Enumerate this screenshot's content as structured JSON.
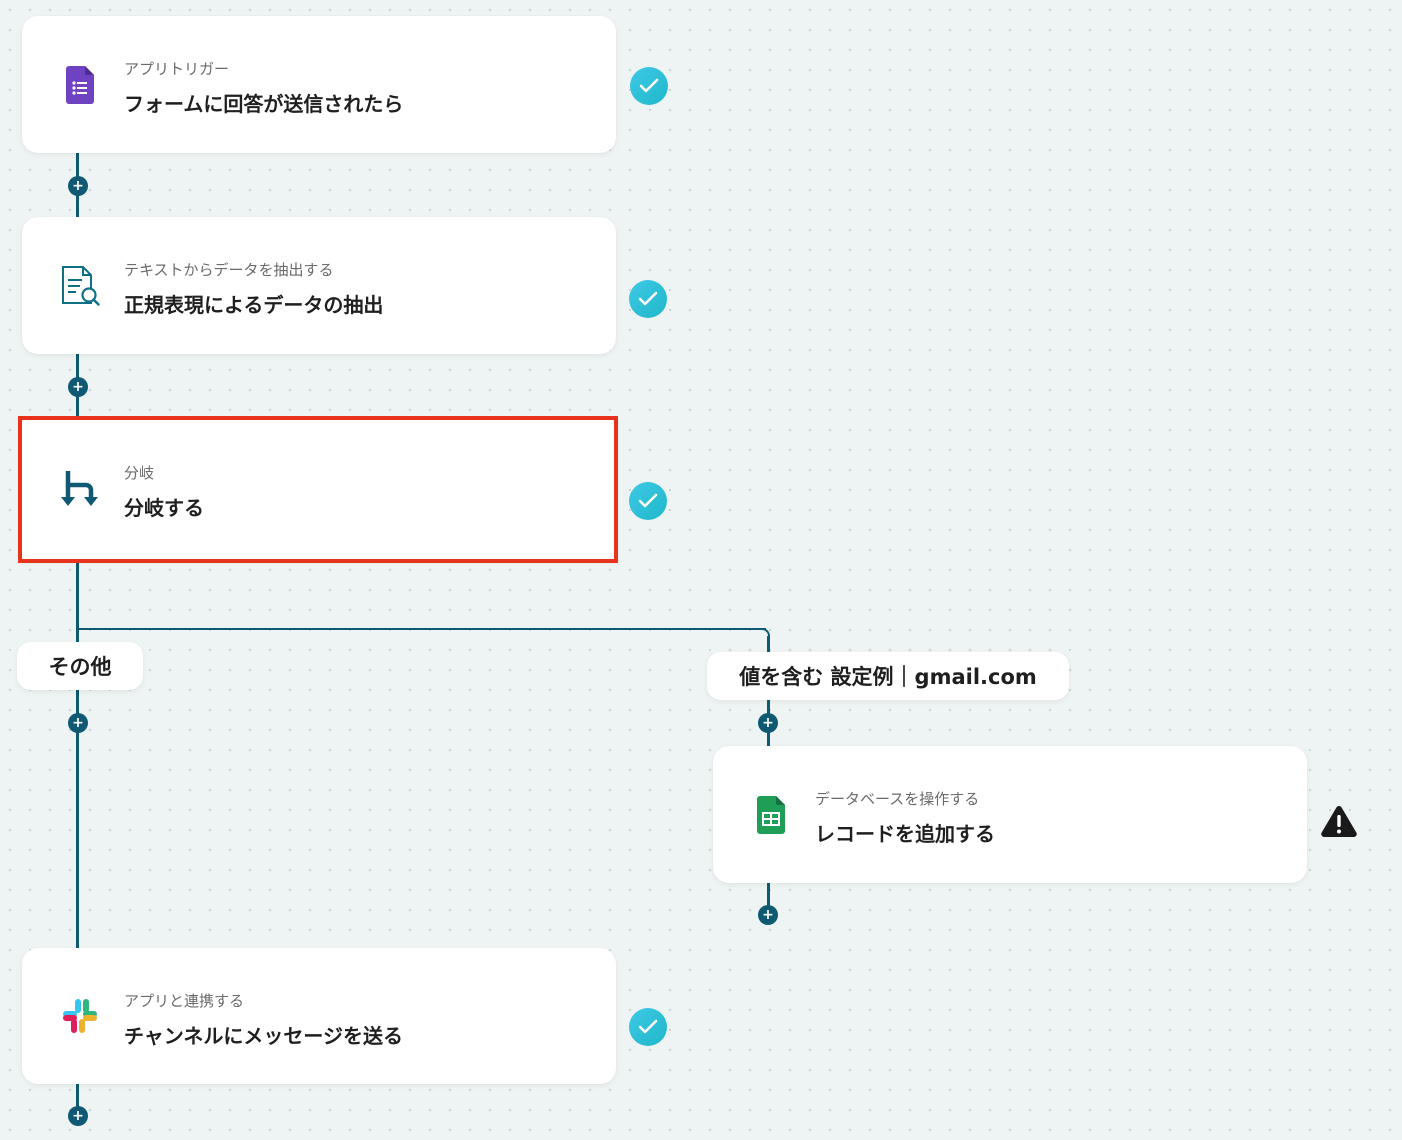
{
  "steps": [
    {
      "sub": "アプリトリガー",
      "main": "フォームに回答が送信されたら",
      "icon": "google-forms-icon",
      "status": "check"
    },
    {
      "sub": "テキストからデータを抽出する",
      "main": "正規表現によるデータの抽出",
      "icon": "document-search-icon",
      "status": "check"
    },
    {
      "sub": "分岐",
      "main": "分岐する",
      "icon": "branch-icon",
      "status": "check"
    },
    {
      "sub": "データベースを操作する",
      "main": "レコードを追加する",
      "icon": "google-sheets-icon",
      "status": "warning"
    },
    {
      "sub": "アプリと連携する",
      "main": "チャンネルにメッセージを送る",
      "icon": "slack-icon",
      "status": "check"
    }
  ],
  "branches": {
    "other_label": "その他",
    "condition_label": "値を含む 設定例｜gmail.com"
  },
  "colors": {
    "line": "#0f5a72",
    "check": "#2cc2da",
    "highlight": "#e8331c",
    "forms": "#6f42c1",
    "sheets": "#1e9e57"
  }
}
